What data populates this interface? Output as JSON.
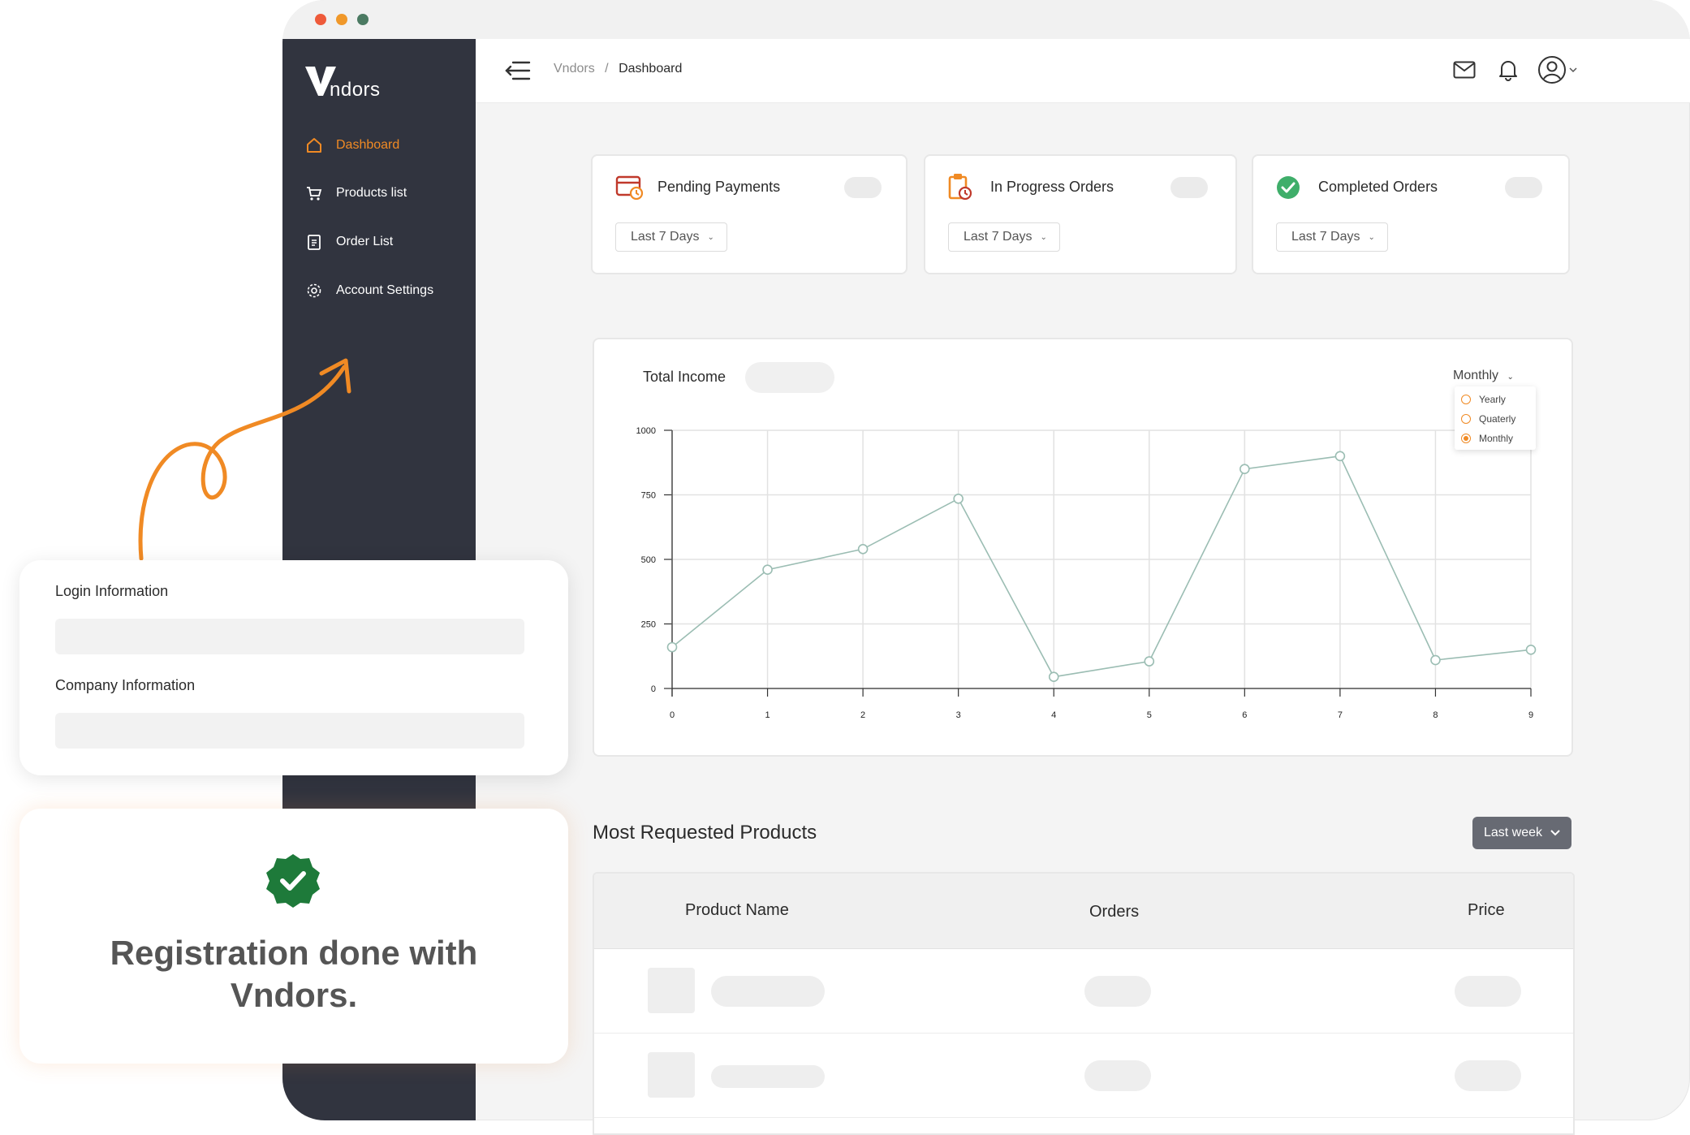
{
  "brand": {
    "name": "Vndors"
  },
  "sidebar": {
    "items": [
      {
        "label": "Dashboard",
        "icon": "home-icon",
        "active": true
      },
      {
        "label": "Products list",
        "icon": "cart-icon",
        "active": false
      },
      {
        "label": "Order List",
        "icon": "clipboard-icon",
        "active": false
      },
      {
        "label": "Account Settings",
        "icon": "gear-icon",
        "active": false
      }
    ]
  },
  "header": {
    "breadcrumb": {
      "root": "Vndors",
      "separator": "/",
      "current": "Dashboard"
    },
    "icons": [
      "menu-collapse-icon",
      "mail-icon",
      "bell-icon",
      "user-avatar-icon"
    ]
  },
  "stats": [
    {
      "title": "Pending Payments",
      "range": "Last 7 Days",
      "icon": "payment-clock-icon"
    },
    {
      "title": "In Progress Orders",
      "range": "Last 7 Days",
      "icon": "clipboard-clock-icon"
    },
    {
      "title": "Completed Orders",
      "range": "Last 7 Days",
      "icon": "check-circle-icon"
    }
  ],
  "income": {
    "title": "Total Income",
    "period_label": "Monthly",
    "options": [
      {
        "label": "Yearly",
        "selected": false
      },
      {
        "label": "Quaterly",
        "selected": false
      },
      {
        "label": "Monthly",
        "selected": true
      }
    ]
  },
  "chart_data": {
    "type": "line",
    "x": [
      0,
      1,
      2,
      3,
      4,
      5,
      6,
      7,
      8,
      9
    ],
    "series": [
      {
        "values": [
          160,
          460,
          540,
          735,
          45,
          105,
          850,
          900,
          110,
          150
        ]
      }
    ],
    "ylim": [
      0,
      1000
    ],
    "yticks": [
      0,
      250,
      500,
      750,
      1000
    ],
    "grid": true,
    "line_color": "#9bbdb3"
  },
  "products": {
    "title": "Most Requested Products",
    "filter": "Last week",
    "columns": [
      "Product Name",
      "Orders",
      "Price"
    ]
  },
  "login_card": {
    "login_label": "Login Information",
    "company_label": "Company Information"
  },
  "registration": {
    "message_line1": "Registration done with",
    "message_line2": "Vndors."
  },
  "colors": {
    "accent": "#f08a24",
    "sidebar": "#31343f",
    "success": "#1e7a3a",
    "check_green": "#3fae6a"
  }
}
